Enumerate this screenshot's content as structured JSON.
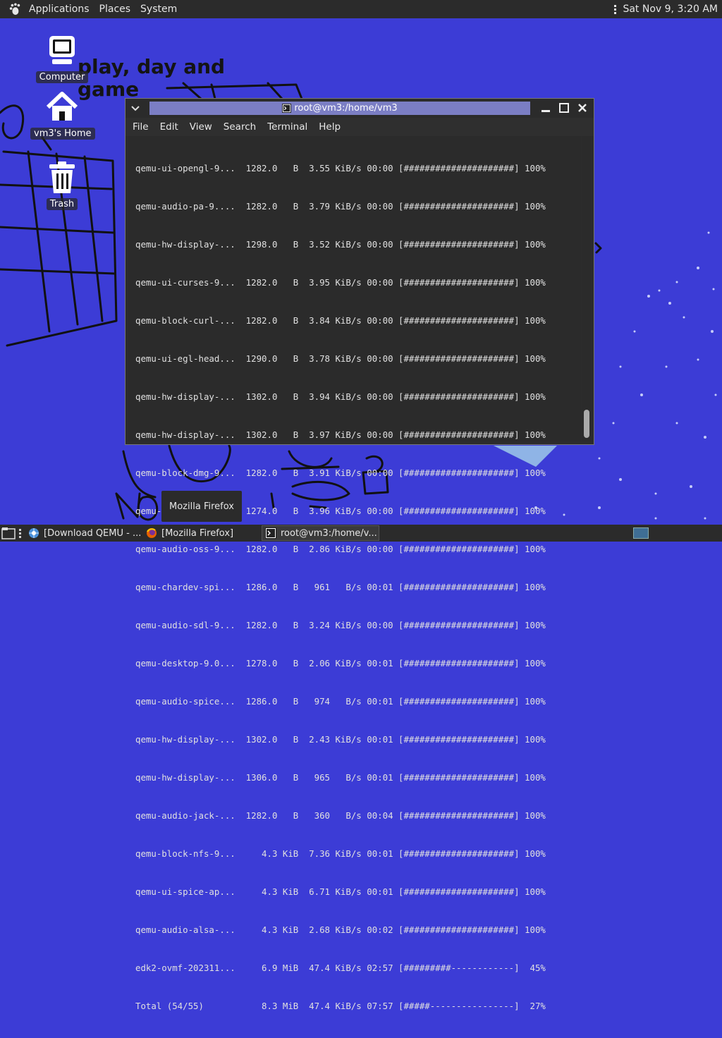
{
  "top_panel": {
    "menus": [
      "Applications",
      "Places",
      "System"
    ],
    "clock": "Sat Nov 9, 3:20 AM"
  },
  "desktop": {
    "background_color": "#3c3cd6",
    "drawn_text": [
      "play, day and",
      "game"
    ],
    "icons": [
      {
        "label": "Computer",
        "icon": "computer-icon"
      },
      {
        "label": "vm3's Home",
        "icon": "home-icon"
      },
      {
        "label": "Trash",
        "icon": "trash-icon"
      }
    ]
  },
  "terminal": {
    "title": "root@vm3:/home/vm3",
    "menus": [
      "File",
      "Edit",
      "View",
      "Search",
      "Terminal",
      "Help"
    ],
    "lines": [
      "qemu-ui-opengl-9...  1282.0   B  3.55 KiB/s 00:00 [#####################] 100%",
      "qemu-audio-pa-9....  1282.0   B  3.79 KiB/s 00:00 [#####################] 100%",
      "qemu-hw-display-...  1298.0   B  3.52 KiB/s 00:00 [#####################] 100%",
      "qemu-ui-curses-9...  1282.0   B  3.95 KiB/s 00:00 [#####################] 100%",
      "qemu-block-curl-...  1282.0   B  3.84 KiB/s 00:00 [#####################] 100%",
      "qemu-ui-egl-head...  1290.0   B  3.78 KiB/s 00:00 [#####################] 100%",
      "qemu-hw-display-...  1302.0   B  3.94 KiB/s 00:00 [#####################] 100%",
      "qemu-hw-display-...  1302.0   B  3.97 KiB/s 00:00 [#####################] 100%",
      "qemu-block-dmg-9...  1282.0   B  3.91 KiB/s 00:00 [#####################] 100%",
      "qemu-base-9.0.2-...  1274.0   B  3.96 KiB/s 00:00 [#####################] 100%",
      "qemu-audio-oss-9...  1282.0   B  2.86 KiB/s 00:00 [#####################] 100%",
      "qemu-chardev-spi...  1286.0   B   961   B/s 00:01 [#####################] 100%",
      "qemu-audio-sdl-9...  1282.0   B  3.24 KiB/s 00:00 [#####################] 100%",
      "qemu-desktop-9.0...  1278.0   B  2.06 KiB/s 00:01 [#####################] 100%",
      "qemu-audio-spice...  1286.0   B   974   B/s 00:01 [#####################] 100%",
      "qemu-hw-display-...  1302.0   B  2.43 KiB/s 00:01 [#####################] 100%",
      "qemu-hw-display-...  1306.0   B   965   B/s 00:01 [#####################] 100%",
      "qemu-audio-jack-...  1282.0   B   360   B/s 00:04 [#####################] 100%",
      "qemu-block-nfs-9...     4.3 KiB  7.36 KiB/s 00:01 [#####################] 100%",
      "qemu-ui-spice-ap...     4.3 KiB  6.71 KiB/s 00:01 [#####################] 100%",
      "qemu-audio-alsa-...     4.3 KiB  2.68 KiB/s 00:02 [#####################] 100%",
      "edk2-ovmf-202311...     6.9 MiB  47.4 KiB/s 02:57 [#########------------]  45%",
      "Total (54/55)           8.3 MiB  47.4 KiB/s 07:57 [#####----------------]  27%"
    ]
  },
  "tooltip": "Mozilla Firefox",
  "taskbar": {
    "tasks": [
      {
        "label": "[Download QEMU - ...",
        "icon": "web-browser-icon"
      },
      {
        "label": "[Mozilla Firefox]",
        "icon": "firefox-icon"
      },
      {
        "label": "root@vm3:/home/v...",
        "icon": "terminal-icon"
      }
    ]
  }
}
